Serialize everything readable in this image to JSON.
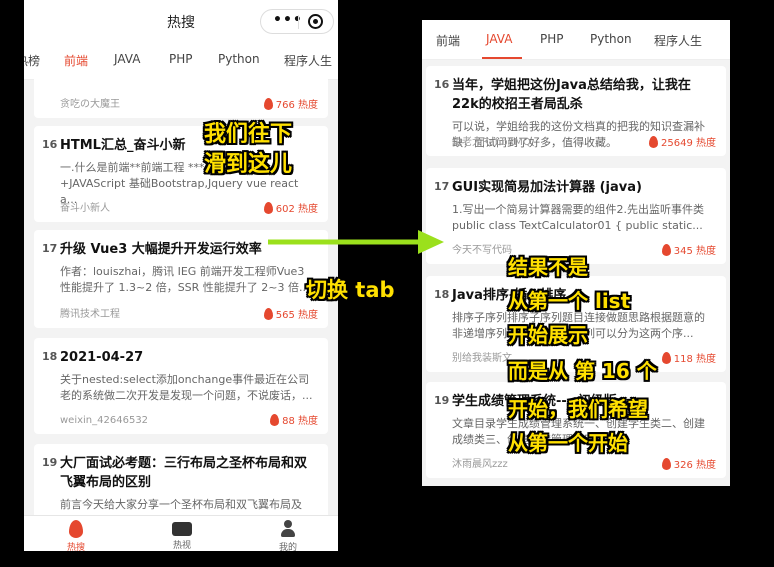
{
  "left": {
    "title": "热搜",
    "tabs": [
      "热榜",
      "前端",
      "JAVA",
      "PHP",
      "Python",
      "程序人生"
    ],
    "partial_card": {
      "author": "贪吃の大魔王",
      "heat": "766 热度"
    },
    "cards": [
      {
        "rank": "16",
        "title": "HTML汇总_奋斗小新",
        "desc": "一.什么是前端**前端工程 *** ML+CSS +JAVAScript 基础Bootstrap,Jquery vue react a...",
        "author": "奋斗小新人",
        "heat": "602 热度"
      },
      {
        "rank": "17",
        "title": "升级 Vue3 大幅提升开发运行效率",
        "desc": "作者：louiszhai，腾讯 IEG 前端开发工程师Vue3 性能提升了 1.3~2 倍，SSR 性能提升了 2~3 倍...",
        "author": "腾讯技术工程",
        "heat": "565 热度"
      },
      {
        "rank": "18",
        "title": "2021-04-27",
        "desc": "关于nested:select添加onchange事件最近在公司老的系统做二次开发是发现一个问题，不说废话，...",
        "author": "weixin_42646532",
        "heat": "88 热度"
      },
      {
        "rank": "19",
        "title": "大厂面试必考题：三行布局之圣杯布局和双飞翼布局的区别",
        "desc": "前言今天给大家分享一个圣杯布局和双飞翼布局及",
        "author": "",
        "heat": ""
      }
    ],
    "bottom_nav": [
      "热搜",
      "热视",
      "我的"
    ]
  },
  "right": {
    "tabs": [
      "前端",
      "JAVA",
      "PHP",
      "Python",
      "程序人生"
    ],
    "cards": [
      {
        "rank": "16",
        "title": "当年，学姐把这份Java总结给我，让我在22k的校招王者局乱杀",
        "desc": "可以说，学姐给我的这份文档真的把我的知识查漏补缺，面试问到了好多，值得收藏。",
        "author": "兔老大RabbitMQ",
        "heat": "25649 热度"
      },
      {
        "rank": "17",
        "title": "GUI实现简易加法计算器 (java)",
        "desc": "1.写出一个简易计算器需要的组件2.先出监听事件类public class TextCalculator01 { public static...",
        "author": "今天不写代码",
        "heat": "345 热度"
      },
      {
        "rank": "18",
        "title": "Java排序-插入排序",
        "desc": "排序子序列排序子序列题目连接做题思路根据题意的非递增序列的区间，那么序列可以分为这两个序...",
        "author": "别给我装斯文",
        "heat": "118 热度"
      },
      {
        "rank": "19",
        "title": "学生成绩管理系统----初级版",
        "desc": "文章目录学生成绩管理系统一、创建学生类二、创建成绩类三、创建成绩管理类四、测...",
        "author": "沐雨晨风zzz",
        "heat": "326 热度"
      }
    ]
  },
  "annotations": {
    "scroll_note": [
      "我们往下",
      "滑到这儿"
    ],
    "switch_tab": "切换 tab",
    "result_note": [
      "结果不是",
      "从第一个 list",
      "开始展示",
      "而是从 第 16 个",
      "开始，我们希望",
      "从第一个开始"
    ]
  },
  "colors": {
    "accent": "#e5482f",
    "annotation": "#ffe000",
    "arrow": "#9be01c"
  }
}
